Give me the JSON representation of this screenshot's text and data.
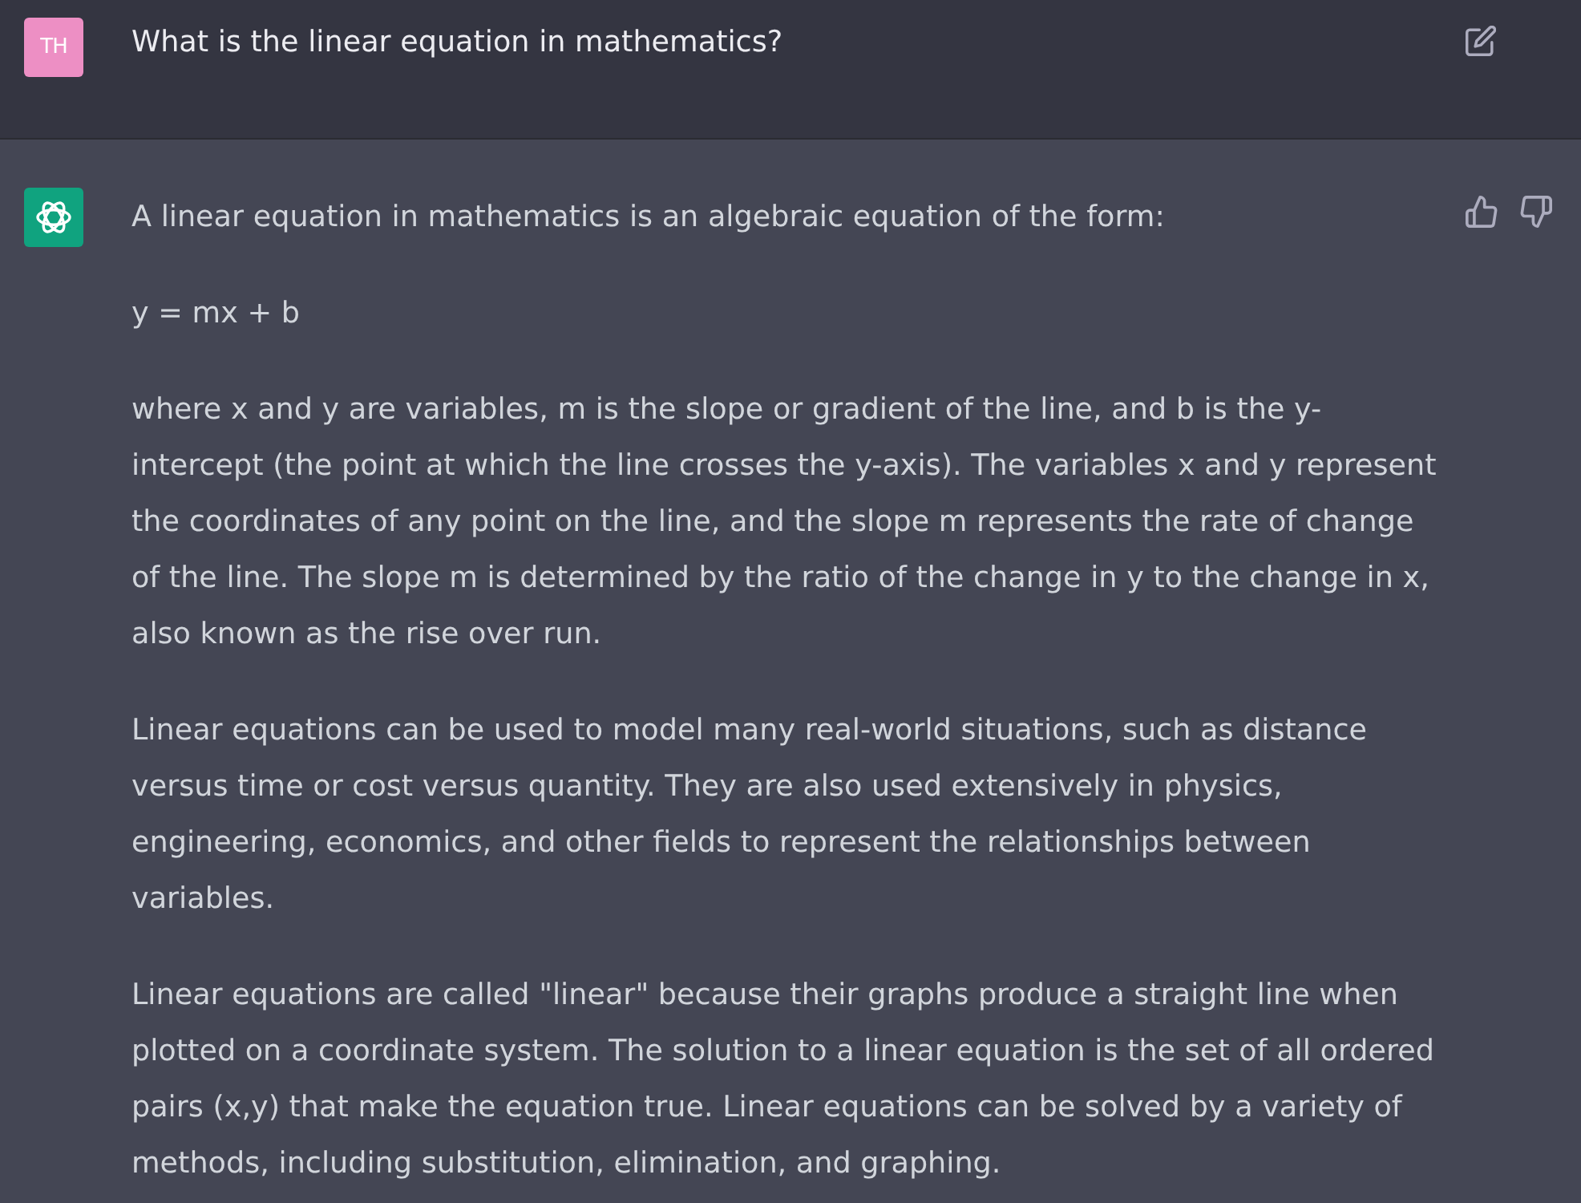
{
  "messages": [
    {
      "kind": "user",
      "avatar": "TH",
      "paragraphs": [
        "What is the linear equation in mathematics?"
      ]
    },
    {
      "kind": "assistant",
      "paragraphs": [
        "A linear equation in mathematics is an algebraic equation of the form:",
        "y = mx + b",
        "where x and y are variables, m is the slope or gradient of the line, and b is the y-intercept (the point at which the line crosses the y-axis). The variables x and y represent the coordinates of any point on the line, and the slope m represents the rate of change of the line. The slope m is determined by the ratio of the change in y to the change in x, also known as the rise over run.",
        "Linear equations can be used to model many real-world situations, such as distance versus time or cost versus quantity. They are also used extensively in physics, engineering, economics, and other fields to represent the relationships between variables.",
        "Linear equations are called \"linear\" because their graphs produce a straight line when plotted on a coordinate system. The solution to a linear equation is the set of all ordered pairs (x,y) that make the equation true. Linear equations can be solved by a variety of methods, including substitution, elimination, and graphing."
      ]
    }
  ]
}
